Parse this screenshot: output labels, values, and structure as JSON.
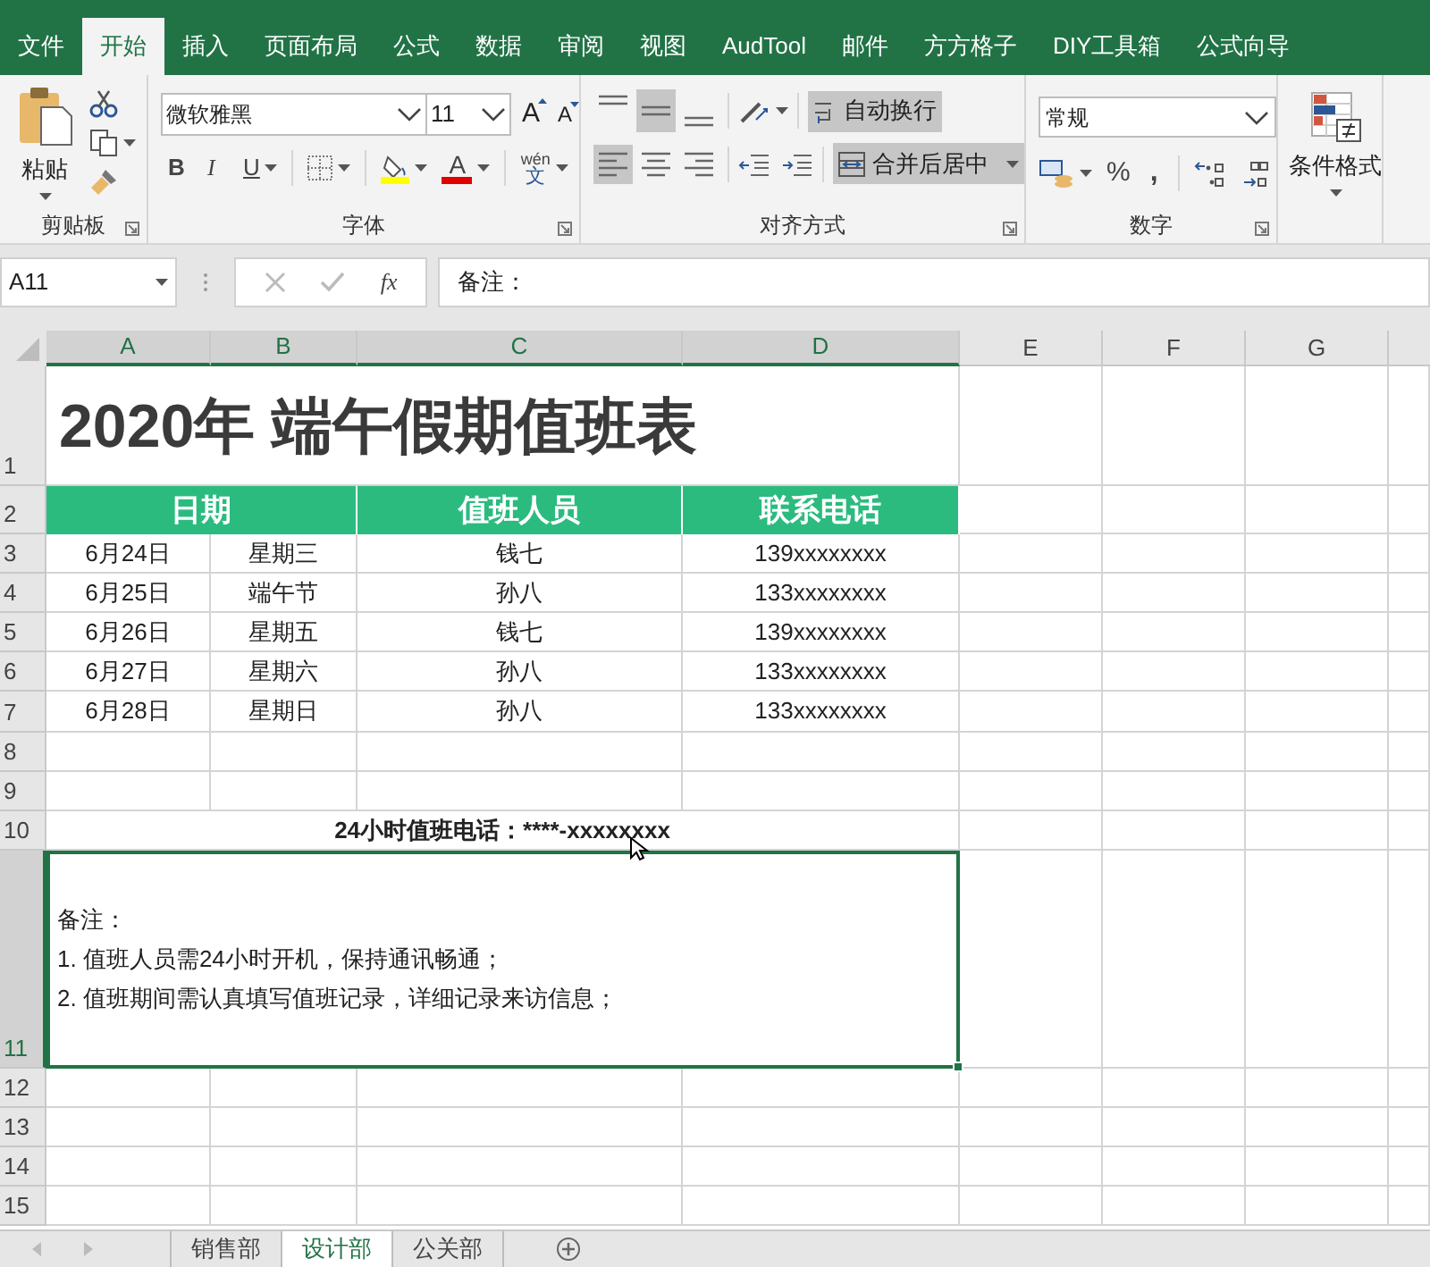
{
  "ribbon_tabs": [
    {
      "label": "文件",
      "selected": false
    },
    {
      "label": "开始",
      "selected": true
    },
    {
      "label": "插入",
      "selected": false
    },
    {
      "label": "页面布局",
      "selected": false
    },
    {
      "label": "公式",
      "selected": false
    },
    {
      "label": "数据",
      "selected": false
    },
    {
      "label": "审阅",
      "selected": false
    },
    {
      "label": "视图",
      "selected": false
    },
    {
      "label": "AudTool",
      "selected": false
    },
    {
      "label": "邮件",
      "selected": false
    },
    {
      "label": "方方格子",
      "selected": false
    },
    {
      "label": "DIY工具箱",
      "selected": false
    },
    {
      "label": "公式向导",
      "selected": false
    }
  ],
  "clipboard": {
    "paste_label": "粘贴",
    "group_label": "剪贴板"
  },
  "font": {
    "name": "微软雅黑",
    "size": "11",
    "grow": "A",
    "shrink": "A",
    "bold": "B",
    "italic": "I",
    "underline": "U",
    "font_color": "A",
    "phonetic_top": "wén",
    "phonetic_bottom": "文",
    "group_label": "字体"
  },
  "alignment": {
    "vertical": [
      {
        "selected": false
      },
      {
        "selected": true
      },
      {
        "selected": false
      }
    ],
    "horizontal": [
      {
        "selected": true
      },
      {
        "selected": false
      },
      {
        "selected": false
      }
    ],
    "wrap": {
      "label": "自动换行",
      "pressed": true
    },
    "merge": {
      "label": "合并后居中",
      "pressed": true
    },
    "group_label": "对齐方式"
  },
  "number": {
    "format": "常规",
    "percent": "%",
    "comma": ",",
    "group_label": "数字"
  },
  "styles": {
    "conditional_label": "条件格式"
  },
  "formula_bar": {
    "name_box": "A11",
    "fx": "fx",
    "formula": "备注："
  },
  "sheet": {
    "column_headers": [
      {
        "label": "A",
        "selected": true
      },
      {
        "label": "B",
        "selected": true
      },
      {
        "label": "C",
        "selected": true
      },
      {
        "label": "D",
        "selected": true
      },
      {
        "label": "E",
        "selected": false
      },
      {
        "label": "F",
        "selected": false
      },
      {
        "label": "G",
        "selected": false
      }
    ],
    "row_headers": [
      {
        "label": "1",
        "selected": false
      },
      {
        "label": "2",
        "selected": false
      },
      {
        "label": "3",
        "selected": false
      },
      {
        "label": "4",
        "selected": false
      },
      {
        "label": "5",
        "selected": false
      },
      {
        "label": "6",
        "selected": false
      },
      {
        "label": "7",
        "selected": false
      },
      {
        "label": "8",
        "selected": false
      },
      {
        "label": "9",
        "selected": false
      },
      {
        "label": "10",
        "selected": false
      },
      {
        "label": "11",
        "selected": true
      },
      {
        "label": "12",
        "selected": false
      },
      {
        "label": "13",
        "selected": false
      },
      {
        "label": "14",
        "selected": false
      },
      {
        "label": "15",
        "selected": false
      }
    ],
    "title": "2020年 端午假期值班表",
    "header": [
      "日期",
      "值班人员",
      "联系电话"
    ],
    "rows": [
      [
        "6月24日",
        "星期三",
        "钱七",
        "139xxxxxxxx"
      ],
      [
        "6月25日",
        "端午节",
        "孙八",
        "133xxxxxxxx"
      ],
      [
        "6月26日",
        "星期五",
        "钱七",
        "139xxxxxxxx"
      ],
      [
        "6月27日",
        "星期六",
        "孙八",
        "133xxxxxxxx"
      ],
      [
        "6月28日",
        "星期日",
        "孙八",
        "133xxxxxxxx"
      ]
    ],
    "hotline": "24小时值班电话：****-xxxxxxxx",
    "note": {
      "lines": [
        "备注：",
        "1. 值班人员需24小时开机，保持通讯畅通；",
        "2. 值班期间需认真填写值班记录，详细记录来访信息；"
      ],
      "selected": true
    }
  },
  "sheet_tabs": [
    {
      "label": "销售部",
      "selected": false
    },
    {
      "label": "设计部",
      "selected": true
    },
    {
      "label": "公关部",
      "selected": false
    }
  ]
}
